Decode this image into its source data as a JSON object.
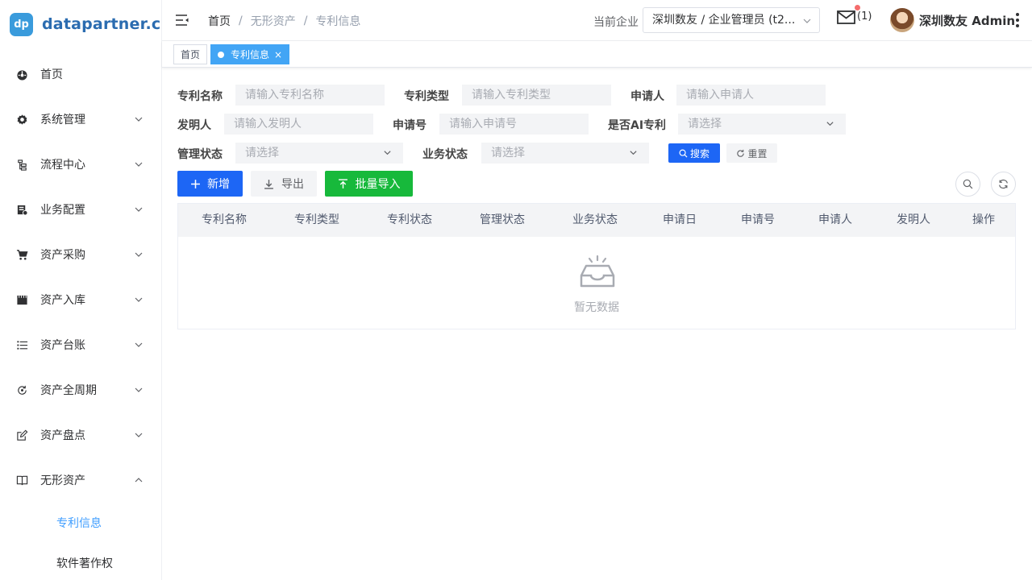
{
  "brand": {
    "logo_text": "dp",
    "name": "datapartner.cn"
  },
  "sidebar": {
    "items": [
      {
        "label": "首页",
        "icon": "dashboard-icon"
      },
      {
        "label": "系统管理",
        "icon": "gear-icon"
      },
      {
        "label": "流程中心",
        "icon": "tree-icon"
      },
      {
        "label": "业务配置",
        "icon": "config-icon"
      },
      {
        "label": "资产采购",
        "icon": "cart-icon"
      },
      {
        "label": "资产入库",
        "icon": "clapper-icon"
      },
      {
        "label": "资产台账",
        "icon": "list-icon"
      },
      {
        "label": "资产全周期",
        "icon": "cycle-icon"
      },
      {
        "label": "资产盘点",
        "icon": "edit-icon"
      },
      {
        "label": "无形资产",
        "icon": "book-icon"
      }
    ],
    "sub_items": [
      {
        "label": "专利信息",
        "active": true
      },
      {
        "label": "软件著作权",
        "active": false
      }
    ]
  },
  "header": {
    "breadcrumb": [
      "首页",
      "无形资产",
      "专利信息"
    ],
    "enterprise_label": "当前企业",
    "enterprise_value": "深圳数友 / 企业管理员 (t2...",
    "mail_count": "(1)",
    "username": "深圳数友 Admin"
  },
  "tags": {
    "home": "首页",
    "active": "专利信息",
    "close": "×"
  },
  "search": {
    "patent_name_label": "专利名称",
    "patent_name_placeholder": "请输入专利名称",
    "patent_type_label": "专利类型",
    "patent_type_placeholder": "请输入专利类型",
    "applicant_label": "申请人",
    "applicant_placeholder": "请输入申请人",
    "inventor_label": "发明人",
    "inventor_placeholder": "请输入发明人",
    "app_no_label": "申请号",
    "app_no_placeholder": "请输入申请号",
    "is_ai_label": "是否AI专利",
    "is_ai_placeholder": "请选择",
    "mgmt_status_label": "管理状态",
    "mgmt_status_placeholder": "请选择",
    "biz_status_label": "业务状态",
    "biz_status_placeholder": "请选择",
    "search_button": "搜索",
    "reset_button": "重置"
  },
  "toolbar": {
    "add": "新增",
    "export": "导出",
    "import": "批量导入"
  },
  "table": {
    "columns": [
      "专利名称",
      "专利类型",
      "专利状态",
      "管理状态",
      "业务状态",
      "申请日",
      "申请号",
      "申请人",
      "发明人",
      "操作"
    ],
    "empty_text": "暂无数据"
  },
  "colors": {
    "primary": "#1d66f5",
    "success": "#17b93b",
    "accent": "#409eff",
    "badge": "#f56c6c"
  }
}
